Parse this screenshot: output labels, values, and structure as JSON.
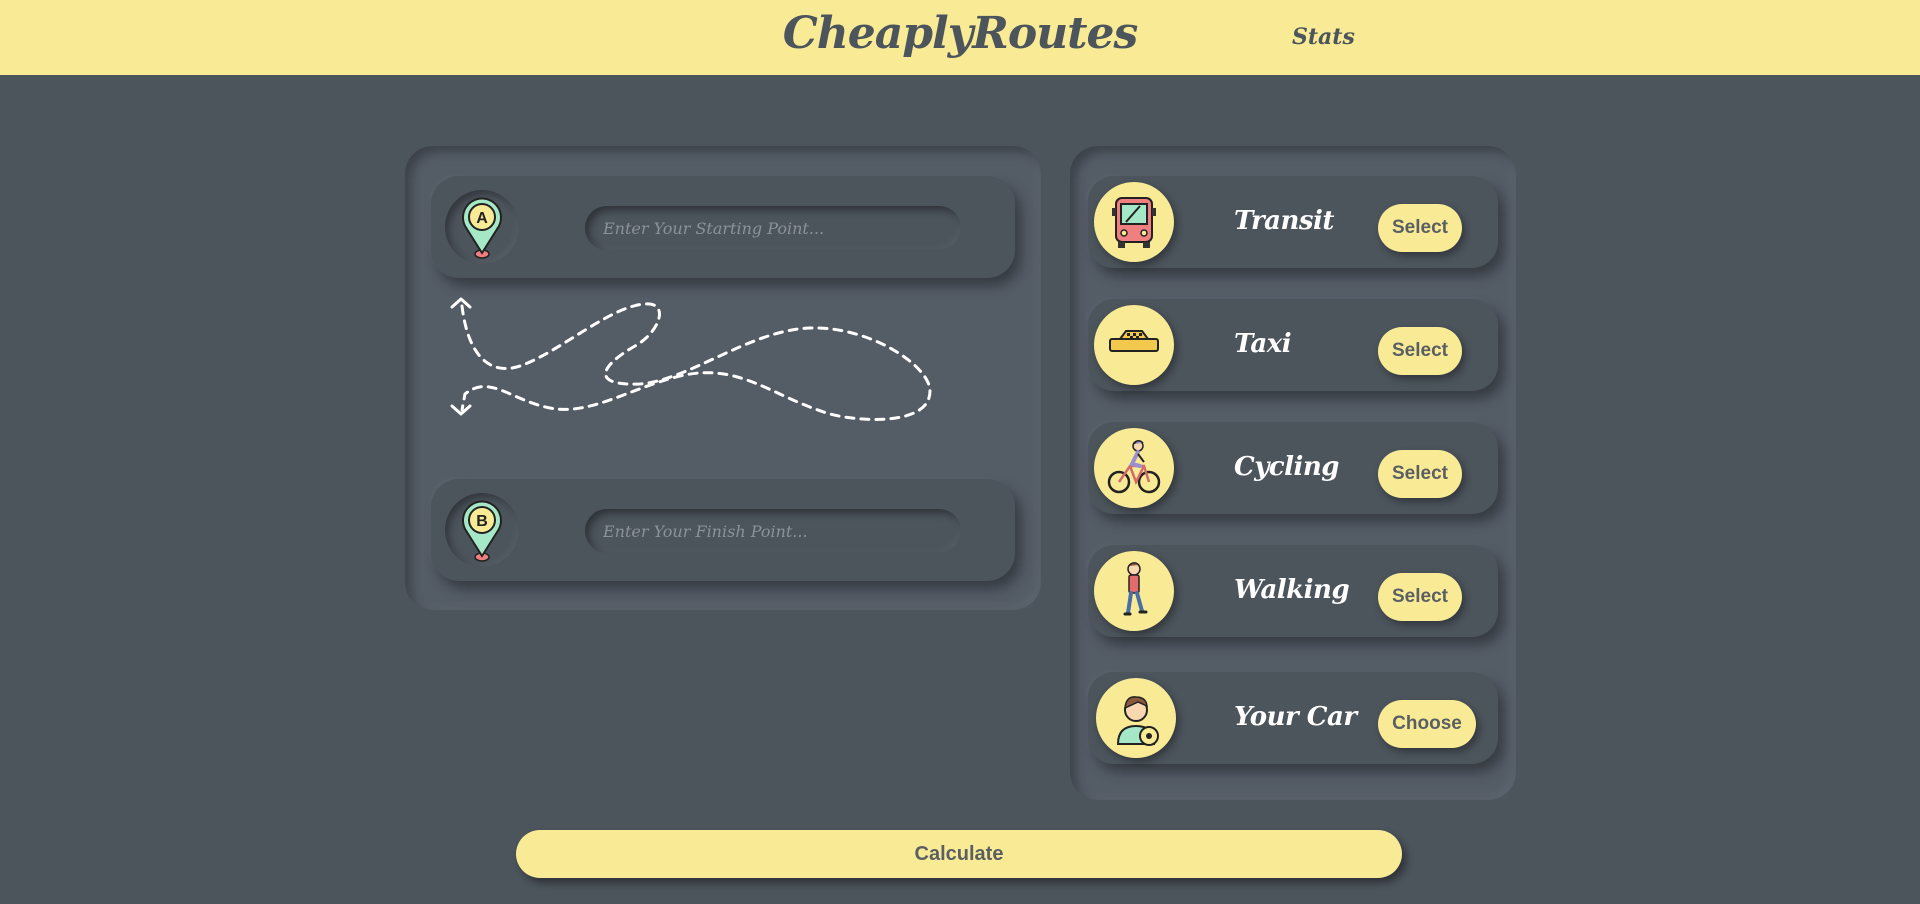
{
  "header": {
    "brand": "CheaplyRoutes",
    "nav_stats": "Stats"
  },
  "route": {
    "start": {
      "pin_letter": "A",
      "placeholder": "Enter Your Starting Point..."
    },
    "finish": {
      "pin_letter": "B",
      "placeholder": "Enter Your Finish Point..."
    }
  },
  "modes": [
    {
      "label": "Transit",
      "button": "Select",
      "icon": "bus-icon"
    },
    {
      "label": "Taxi",
      "button": "Select",
      "icon": "taxi-icon"
    },
    {
      "label": "Cycling",
      "button": "Select",
      "icon": "cyclist-icon"
    },
    {
      "label": "Walking",
      "button": "Select",
      "icon": "walker-icon"
    },
    {
      "label": "Your Car",
      "button": "Choose",
      "icon": "driver-icon"
    }
  ],
  "calculate_label": "Calculate",
  "colors": {
    "background": "#4c545c",
    "accent_yellow": "#f9eb95",
    "pin_teal": "#a5e8c8",
    "pin_red": "#f08080"
  }
}
